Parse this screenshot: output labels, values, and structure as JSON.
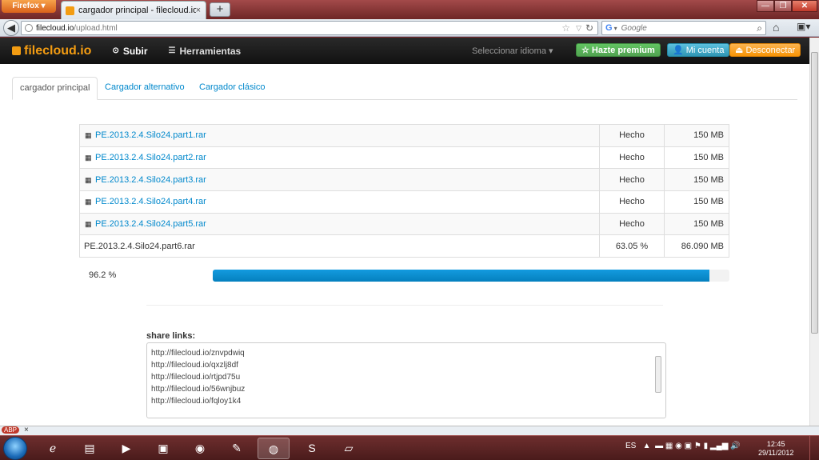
{
  "browser": {
    "firefox_label": "Firefox",
    "tab_title": "cargador principal - filecloud.io",
    "tab_close": "×",
    "new_tab": "+",
    "url_host": "filecloud.io",
    "url_path": "/upload.html",
    "search_placeholder": "Google",
    "search_engine_icon": "G"
  },
  "site": {
    "brand": "filecloud.io",
    "nav": {
      "upload": "Subir",
      "tools": "Herramientas"
    },
    "language": "Seleccionar idioma ▾",
    "premium": "☆ Hazte premium",
    "account": "Mi cuenta",
    "logout": "Desconectar",
    "tabs": [
      "cargador principal",
      "Cargador alternativo",
      "Cargador clásico"
    ]
  },
  "uploads": [
    {
      "name": "PE.2013.2.4.Silo24.part1.rar",
      "status": "Hecho",
      "size": "150 MB",
      "done": true
    },
    {
      "name": "PE.2013.2.4.Silo24.part2.rar",
      "status": "Hecho",
      "size": "150 MB",
      "done": true
    },
    {
      "name": "PE.2013.2.4.Silo24.part3.rar",
      "status": "Hecho",
      "size": "150 MB",
      "done": true
    },
    {
      "name": "PE.2013.2.4.Silo24.part4.rar",
      "status": "Hecho",
      "size": "150 MB",
      "done": true
    },
    {
      "name": "PE.2013.2.4.Silo24.part5.rar",
      "status": "Hecho",
      "size": "150 MB",
      "done": true
    },
    {
      "name": "PE.2013.2.4.Silo24.part6.rar",
      "status": "63.05 %",
      "size": "86.090 MB",
      "done": false
    }
  ],
  "overall_progress": {
    "label": "96.2 %",
    "value": 0.962
  },
  "share": {
    "label": "share links:",
    "links": [
      "http://filecloud.io/znvpdwiq",
      "http://filecloud.io/qxzlj8df",
      "http://filecloud.io/rtjpd75u",
      "http://filecloud.io/56wnjbuz",
      "http://filecloud.io/fqloy1k4"
    ]
  },
  "statusbar": {
    "addon_label": "ABP",
    "close": "×"
  },
  "taskbar": {
    "language": "ES",
    "time": "12:45",
    "date": "29/11/2012"
  },
  "colors": {
    "link": "#0088cc",
    "brand": "#f39c12",
    "progress": "#149bdf",
    "premium": "#51a351",
    "account": "#2f96b4",
    "logout": "#f89406"
  }
}
